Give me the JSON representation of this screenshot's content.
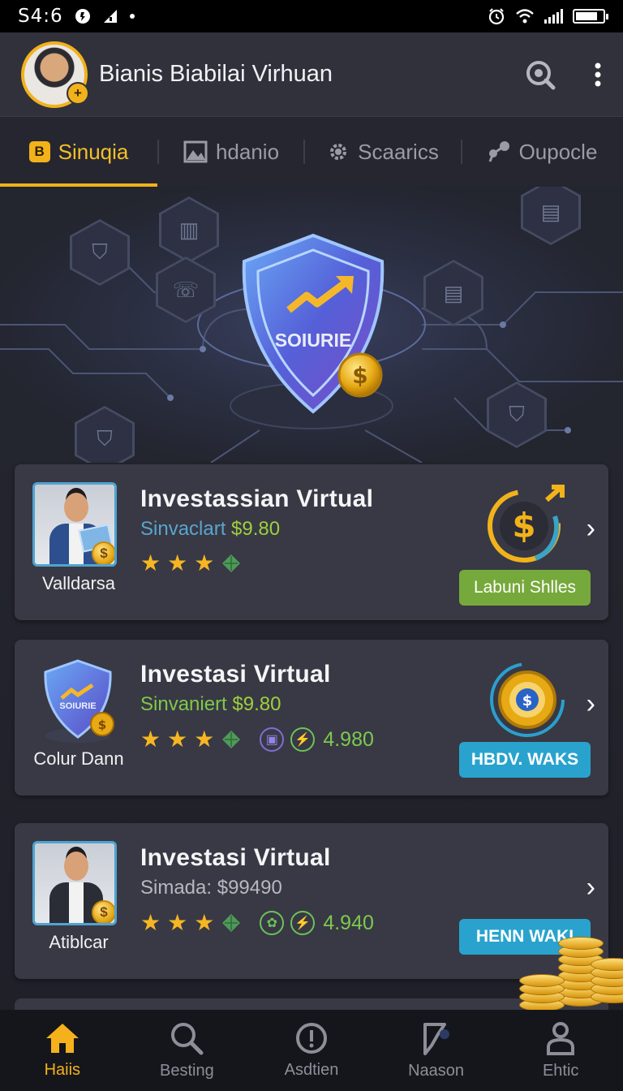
{
  "status_bar": {
    "time": "S4:6"
  },
  "header": {
    "title": "Bianis Biabilai Virhuan",
    "avatar_badge": "+"
  },
  "tabs": [
    {
      "label": "Sinuqia",
      "icon": "b-badge-icon",
      "badge": "B",
      "active": true
    },
    {
      "label": "hdanio",
      "icon": "image-icon",
      "active": false
    },
    {
      "label": "Scaarics",
      "icon": "gear-icon",
      "active": false
    },
    {
      "label": "Oupocle",
      "icon": "share-icon",
      "active": false
    }
  ],
  "hero": {
    "shield_text": "SOIURIE"
  },
  "cards": [
    {
      "title": "Investassian Virtual",
      "sub_label": "Sinvaclart",
      "sub_amount": "$9.80",
      "caption": "Valldarsa",
      "stars": 3,
      "button": "Labuni Shlles",
      "button_color": "#76a93b"
    },
    {
      "title": "Investasi Virtual",
      "sub_label": "Sinvaniert",
      "sub_amount": "$9.80",
      "caption": "Colur Dann",
      "thumb_shield_text": "SOIURIE",
      "stars": 3,
      "meta_value": "4.980",
      "button": "HBDV. WAKS",
      "button_color": "#29a3cd"
    },
    {
      "title": "Investasi Virtual",
      "sub_label": "Simada:",
      "sub_amount": "$99490",
      "caption": "Atiblcar",
      "stars": 3,
      "meta_value": "4.940",
      "button": "HENN WAKI",
      "button_color": "#29a3cd"
    }
  ],
  "bottom_nav": [
    {
      "label": "Haiis",
      "icon": "home-icon",
      "active": true
    },
    {
      "label": "Besting",
      "icon": "search-icon",
      "active": false
    },
    {
      "label": "Asdtien",
      "icon": "info-circle-icon",
      "active": false
    },
    {
      "label": "Naason",
      "icon": "flag-icon",
      "active": false
    },
    {
      "label": "Ehtic",
      "icon": "profile-icon",
      "active": false
    }
  ],
  "colors": {
    "accent": "#f2b21b",
    "green": "#76a93b",
    "blue": "#29a3cd",
    "background": "#24252e"
  }
}
